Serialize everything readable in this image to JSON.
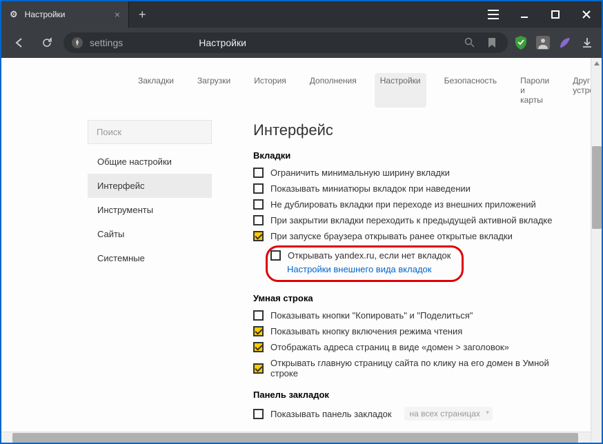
{
  "tab": {
    "title": "Настройки"
  },
  "address": {
    "url_text": "settings",
    "page_title": "Настройки"
  },
  "top_nav": {
    "items": [
      "Закладки",
      "Загрузки",
      "История",
      "Дополнения",
      "Настройки",
      "Безопасность",
      "Пароли и карты",
      "Другие устройства"
    ],
    "active_index": 4
  },
  "sidebar": {
    "search_placeholder": "Поиск",
    "items": [
      "Общие настройки",
      "Интерфейс",
      "Инструменты",
      "Сайты",
      "Системные"
    ],
    "active_index": 1
  },
  "settings": {
    "title": "Интерфейс",
    "tabs_section": {
      "title": "Вкладки",
      "opts": [
        {
          "label": "Ограничить минимальную ширину вкладки",
          "checked": false
        },
        {
          "label": "Показывать миниатюры вкладок при наведении",
          "checked": false
        },
        {
          "label": "Не дублировать вкладки при переходе из внешних приложений",
          "checked": false
        },
        {
          "label": "При закрытии вкладки переходить к предыдущей активной вкладке",
          "checked": false
        },
        {
          "label": "При запуске браузера открывать ранее открытые вкладки",
          "checked": true
        },
        {
          "label": "Открывать yandex.ru, если нет вкладок",
          "checked": false
        }
      ],
      "link": "Настройки внешнего вида вкладок"
    },
    "smartbar_section": {
      "title": "Умная строка",
      "opts": [
        {
          "label": "Показывать кнопки \"Копировать\" и \"Поделиться\"",
          "checked": false
        },
        {
          "label": "Показывать кнопку включения режима чтения",
          "checked": true
        },
        {
          "label": "Отображать адреса страниц в виде «домен > заголовок»",
          "checked": true
        },
        {
          "label": "Открывать главную страницу сайта по клику на его домен в Умной строке",
          "checked": true
        }
      ]
    },
    "bookmarks_section": {
      "title": "Панель закладок",
      "opts": [
        {
          "label": "Показывать панель закладок",
          "checked": false,
          "dropdown": "на всех страницах"
        }
      ]
    }
  }
}
